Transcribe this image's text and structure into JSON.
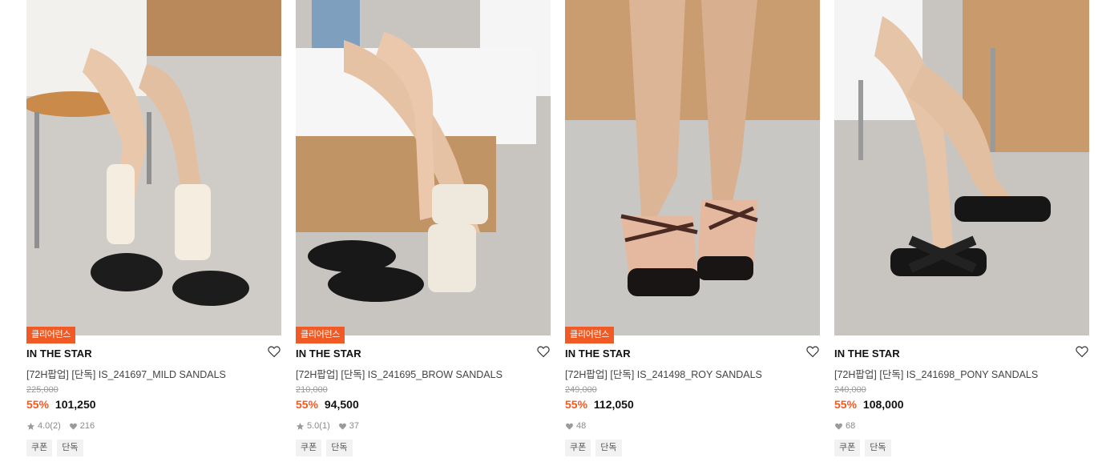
{
  "colors": {
    "accent": "#f05a24",
    "tag_bg": "#f2f2f2"
  },
  "products": [
    {
      "badge": "클리어런스",
      "brand": "IN THE STAR",
      "title": "[72H팝업] [단독] IS_241697_MILD SANDALS",
      "original_price": "225,000",
      "discount": "55%",
      "price": "101,250",
      "rating": "4.0",
      "review_count": "(2)",
      "likes": "216",
      "tags": [
        "쿠폰",
        "단독"
      ],
      "image_icon": "product-photo-black-sandals-with-socks"
    },
    {
      "badge": "클리어런스",
      "brand": "IN THE STAR",
      "title": "[72H팝업] [단독] IS_241695_BROW SANDALS",
      "original_price": "210,000",
      "discount": "55%",
      "price": "94,500",
      "rating": "5.0",
      "review_count": "(1)",
      "likes": "37",
      "tags": [
        "쿠폰",
        "단독"
      ],
      "image_icon": "product-photo-black-and-ivory-heeled-sandals"
    },
    {
      "badge": "클리어런스",
      "brand": "IN THE STAR",
      "title": "[72H팝업] [단독] IS_241498_ROY SANDALS",
      "original_price": "249,000",
      "discount": "55%",
      "price": "112,050",
      "likes": "48",
      "tags": [
        "쿠폰",
        "단독"
      ],
      "image_icon": "product-photo-brown-strappy-sandals"
    },
    {
      "brand": "IN THE STAR",
      "title": "[72H팝업] [단독] IS_241698_PONY SANDALS",
      "original_price": "240,000",
      "discount": "55%",
      "price": "108,000",
      "likes": "68",
      "tags": [
        "쿠폰",
        "단독"
      ],
      "image_icon": "product-photo-black-cross-strap-sandals"
    }
  ]
}
